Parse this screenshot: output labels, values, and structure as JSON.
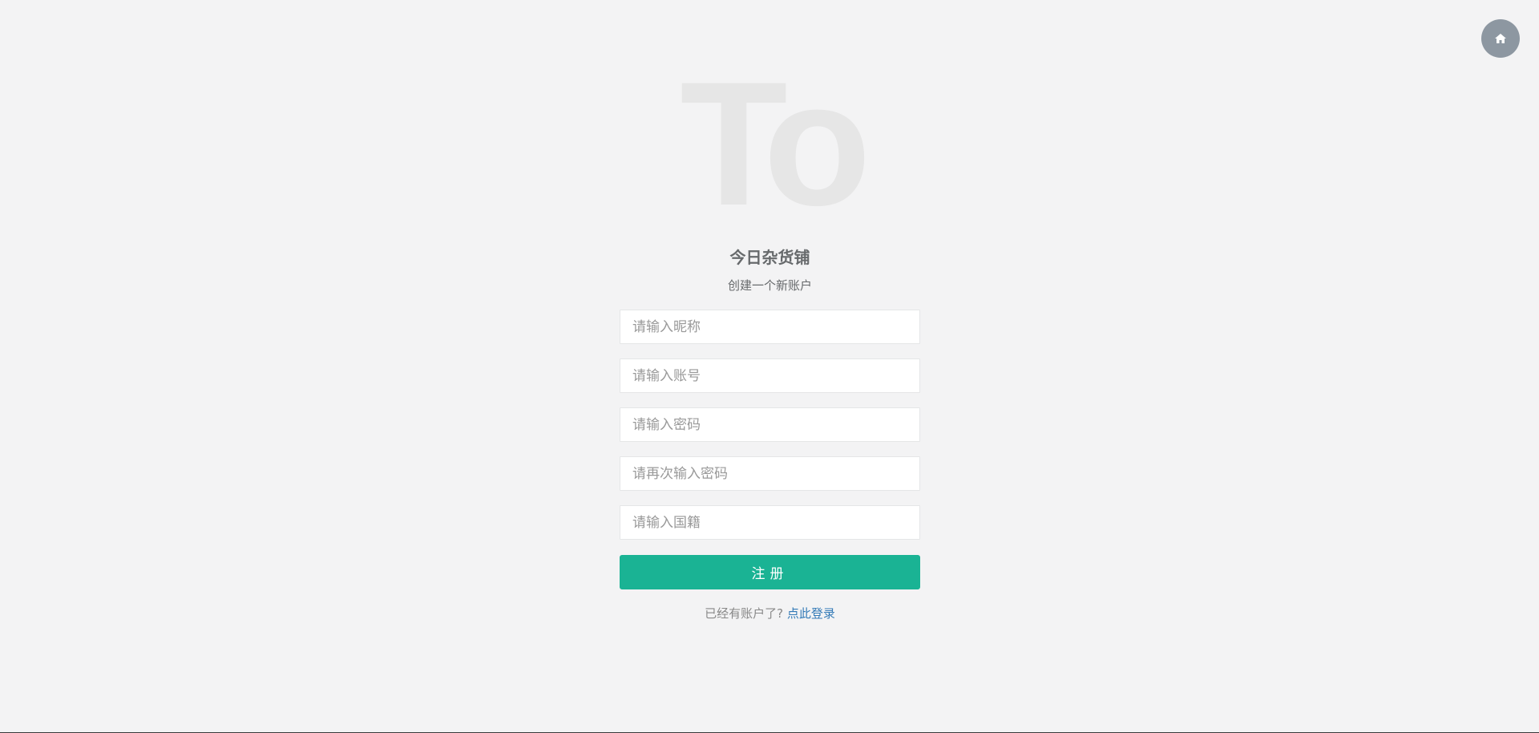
{
  "header": {
    "home_icon": "home-icon"
  },
  "logo": {
    "text": "To"
  },
  "brand": {
    "title": "今日杂货铺",
    "subtitle": "创建一个新账户"
  },
  "form": {
    "nickname": {
      "placeholder": "请输入昵称",
      "value": ""
    },
    "account": {
      "placeholder": "请输入账号",
      "value": ""
    },
    "password": {
      "placeholder": "请输入密码",
      "value": ""
    },
    "password_confirm": {
      "placeholder": "请再次输入密码",
      "value": ""
    },
    "nationality": {
      "placeholder": "请输入国籍",
      "value": ""
    },
    "submit_label": "注册"
  },
  "footer": {
    "prompt": "已经有账户了?",
    "login_link": "点此登录"
  },
  "colors": {
    "background": "#f3f3f4",
    "primary": "#1ab394",
    "link": "#337ab7",
    "home_button": "#8d97a1",
    "logo": "#e6e6e6"
  }
}
